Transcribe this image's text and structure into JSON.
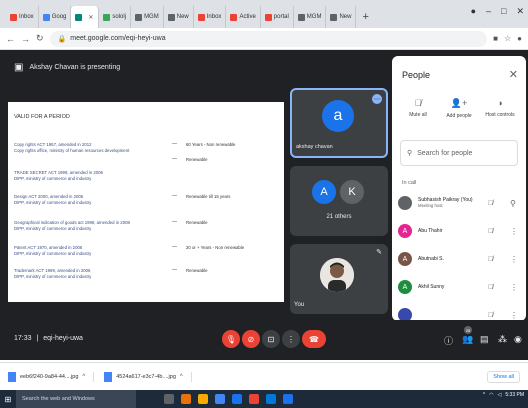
{
  "browser": {
    "tabs": [
      {
        "label": "Inbox",
        "fav": "#ea4335"
      },
      {
        "label": "Goog",
        "fav": "#4285f4"
      },
      {
        "label": "",
        "fav": "#00897b",
        "active": true
      },
      {
        "label": "sololj",
        "fav": "#34a853"
      },
      {
        "label": "MGM",
        "fav": "#5f6368"
      },
      {
        "label": "New",
        "fav": "#5f6368"
      },
      {
        "label": "Inbox",
        "fav": "#ea4335"
      },
      {
        "label": "Active",
        "fav": "#ea4335"
      },
      {
        "label": "portal",
        "fav": "#ea4335"
      },
      {
        "label": "MGM",
        "fav": "#5f6368"
      },
      {
        "label": "New",
        "fav": "#5f6368"
      }
    ],
    "new_tab": "+",
    "url": "meet.google.com/eqi-heyi-uwa"
  },
  "meet": {
    "presenting_text": "Akshay Chavan is presenting",
    "slide": {
      "heading": "VALID FOR A PERIOD",
      "rows": [
        {
          "line1": "Copy rights ACT 1957, amended in 2012",
          "line2": "Copy rights office, ministry of human resources development",
          "term": "60 Years - Non renewable"
        },
        {
          "line1": "",
          "line2": "",
          "term": "Renewable"
        },
        {
          "line1": "TRADE SECRET ACT 1999, amended in 2006",
          "line2": "DIPP, ministry of commerce and industry",
          "term": ""
        },
        {
          "line1": "Design ACT 2000, amended in 2006",
          "line2": "DIPP, ministry of commerce and industry",
          "term": "Renewable till 15 years"
        },
        {
          "line1": "Geographical indication of goods act 1999, amended in 2008",
          "line2": "DIPP, ministry of commerce and industry",
          "term": "Renewable"
        },
        {
          "line1": "Patent ACT 1970, amended in 2006",
          "line2": "DIPP, ministry of commerce and industry",
          "term": "20 or + Years - Non renewable"
        },
        {
          "line1": "Trademark ACT 1999, amended in 2006",
          "line2": "DIPP, ministry of commerce and industry",
          "term": "Renewable"
        }
      ]
    },
    "tiles": {
      "presenter_initial": "a",
      "presenter_name": "akshay chavan",
      "others_initials": [
        "A",
        "K"
      ],
      "others_label": "21 others",
      "self_label": "You"
    }
  },
  "people_panel": {
    "title": "People",
    "controls": [
      "Mute all",
      "Add people",
      "Host controls"
    ],
    "search_placeholder": "Search for people",
    "in_call_label": "In call",
    "participants": [
      {
        "initial": "",
        "name": "Subhasish Paikray (You)",
        "sub": "Meeting host",
        "color": "#5f6368",
        "photo": true
      },
      {
        "initial": "A",
        "name": "Abu Thahir",
        "sub": "",
        "color": "#e52592"
      },
      {
        "initial": "A",
        "name": "Abutnabi S.",
        "sub": "",
        "color": "#795548"
      },
      {
        "initial": "A",
        "name": "Akhil Sunny",
        "sub": "",
        "color": "#1e8e3e"
      },
      {
        "initial": "",
        "name": "",
        "sub": "",
        "color": "#3949ab"
      }
    ]
  },
  "controls_bar": {
    "time": "17:33",
    "separator": "|",
    "meeting_code": "eqi-heyi-uwa",
    "participant_count": "28"
  },
  "downloads": {
    "items": [
      "eeb6f240-9a84-44....jpg",
      "4524a617-e3c7-4b....jpg"
    ],
    "show_all": "Show all"
  },
  "taskbar": {
    "search_placeholder": "Search the web and Windows",
    "app_colors": [
      "#5f6368",
      "#e8710a",
      "#f9ab00",
      "#4285f4",
      "#1a73e8",
      "#ea4335",
      "#0078d7",
      "#1a73e8"
    ],
    "clock": "5:33 PM"
  }
}
